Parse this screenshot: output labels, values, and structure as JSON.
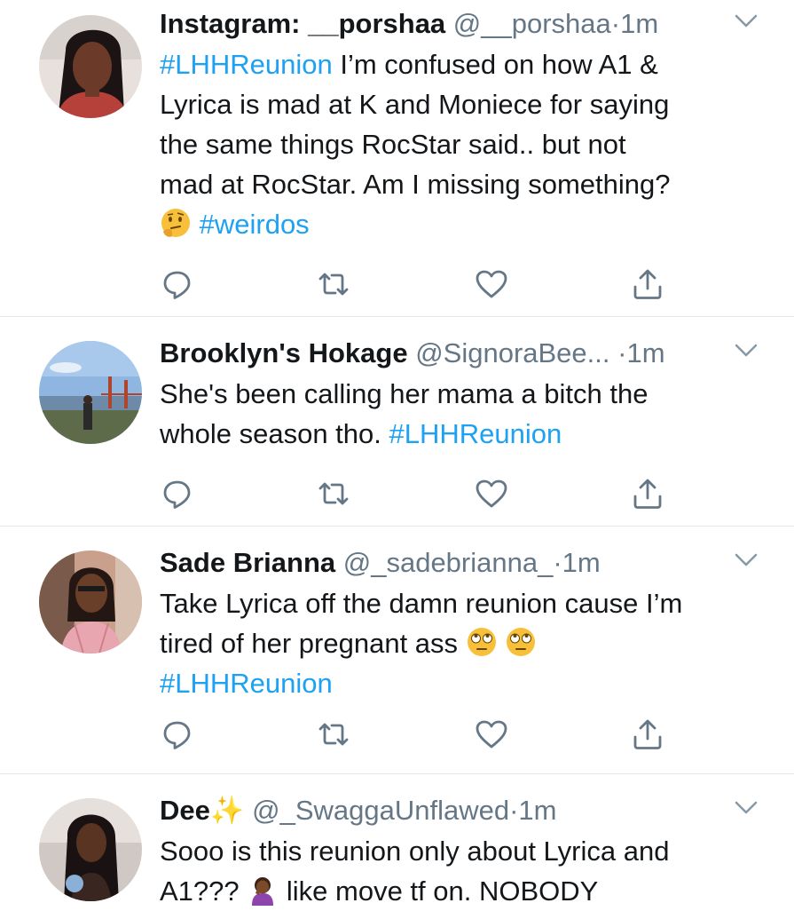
{
  "tweets": [
    {
      "name": "Instagram: __porshaa",
      "handle": "@__porshaa",
      "dot": "·",
      "time": "1m",
      "line1_tag": "#LHHReunion",
      "line1": " I’m confused on how A1 &",
      "line2": "Lyrica is mad at K and Moniece for saying",
      "line3": "the same things RocStar said.. but not",
      "line4": "mad at RocStar. Am I missing something?",
      "line5_tag": "#weirdos",
      "emoji": "thinking-face"
    },
    {
      "name": "Brooklyn's Hokage",
      "handle": "@SignoraBee...",
      "dot": "·",
      "time": "1m",
      "line1": "She's been calling her mama a bitch the",
      "line2": "whole season tho. ",
      "line2_tag": "#LHHReunion"
    },
    {
      "name": "Sade Brianna",
      "handle": "@_sadebrianna_",
      "dot": "·",
      "time": "1m",
      "line1": "Take Lyrica off the damn reunion cause I’m",
      "line2": "tired of her pregnant ass ",
      "line3_tag": "#LHHReunion",
      "emoji": "rolling-eyes-face"
    },
    {
      "name": "Dee",
      "handle": "@_SwaggaUnflawed",
      "dot": "·",
      "time": "1m",
      "line1": "Sooo is this reunion only about Lyrica and",
      "line2a": "A1???",
      "line2b": " like move tf on. NOBODY",
      "emoji": "person-facepalming"
    }
  ],
  "icons": {
    "reply": "reply-icon",
    "retweet": "retweet-icon",
    "like": "heart-icon",
    "share": "share-icon",
    "more": "chevron-down-icon"
  },
  "colors": {
    "hashtag": "#1da1f2",
    "secondary": "#657786",
    "divider": "#e1e8ed"
  }
}
